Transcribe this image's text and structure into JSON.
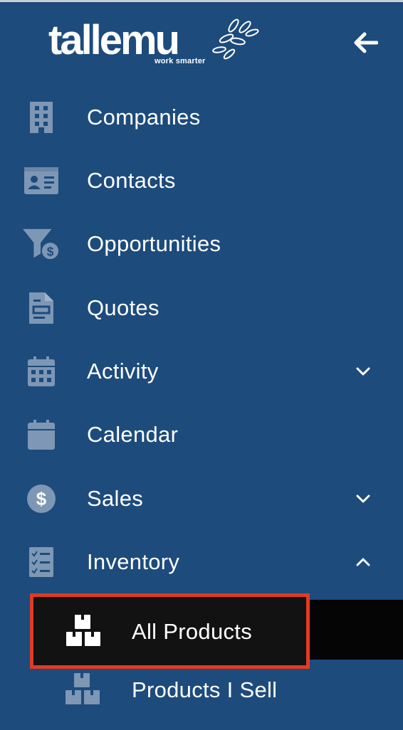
{
  "brand": {
    "name": "tallemu",
    "tagline": "work smarter"
  },
  "header": {
    "collapse_icon": "arrow-left-icon"
  },
  "nav": {
    "items": [
      {
        "label": "Companies",
        "icon": "building-icon"
      },
      {
        "label": "Contacts",
        "icon": "contact-card-icon"
      },
      {
        "label": "Opportunities",
        "icon": "funnel-dollar-icon"
      },
      {
        "label": "Quotes",
        "icon": "document-icon"
      },
      {
        "label": "Activity",
        "icon": "calendar-grid-icon",
        "expandable": true,
        "expanded": false
      },
      {
        "label": "Calendar",
        "icon": "calendar-icon"
      },
      {
        "label": "Sales",
        "icon": "dollar-circle-icon",
        "expandable": true,
        "expanded": false
      },
      {
        "label": "Inventory",
        "icon": "checklist-icon",
        "expandable": true,
        "expanded": true
      }
    ],
    "inventory_children": [
      {
        "label": "All Products",
        "icon": "boxes-icon",
        "active": true
      },
      {
        "label": "Products I Sell",
        "icon": "boxes-icon",
        "active": false
      }
    ]
  },
  "colors": {
    "sidebar_bg": "#1d4b7c",
    "icon_muted": "#7d97b5",
    "active_bg": "#121212",
    "highlight_border": "#e23a24"
  }
}
